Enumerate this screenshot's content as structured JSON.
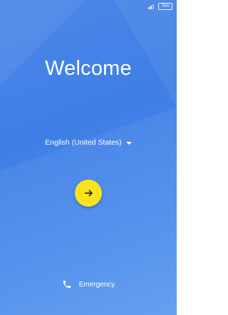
{
  "status": {
    "signal_icon": "signal-icon",
    "battery_icon": "battery-icon",
    "battery_level": "76%"
  },
  "welcome": {
    "title": "Welcome"
  },
  "language": {
    "selected": "English (United States)",
    "dropdown_icon": "caret-down-icon"
  },
  "next": {
    "icon": "arrow-right-icon",
    "color": "#f8e41c"
  },
  "emergency": {
    "label": "Emergency",
    "icon": "phone-icon"
  },
  "colors": {
    "background": "#4a86e8",
    "accent": "#f8e41c",
    "text": "#ffffff"
  }
}
